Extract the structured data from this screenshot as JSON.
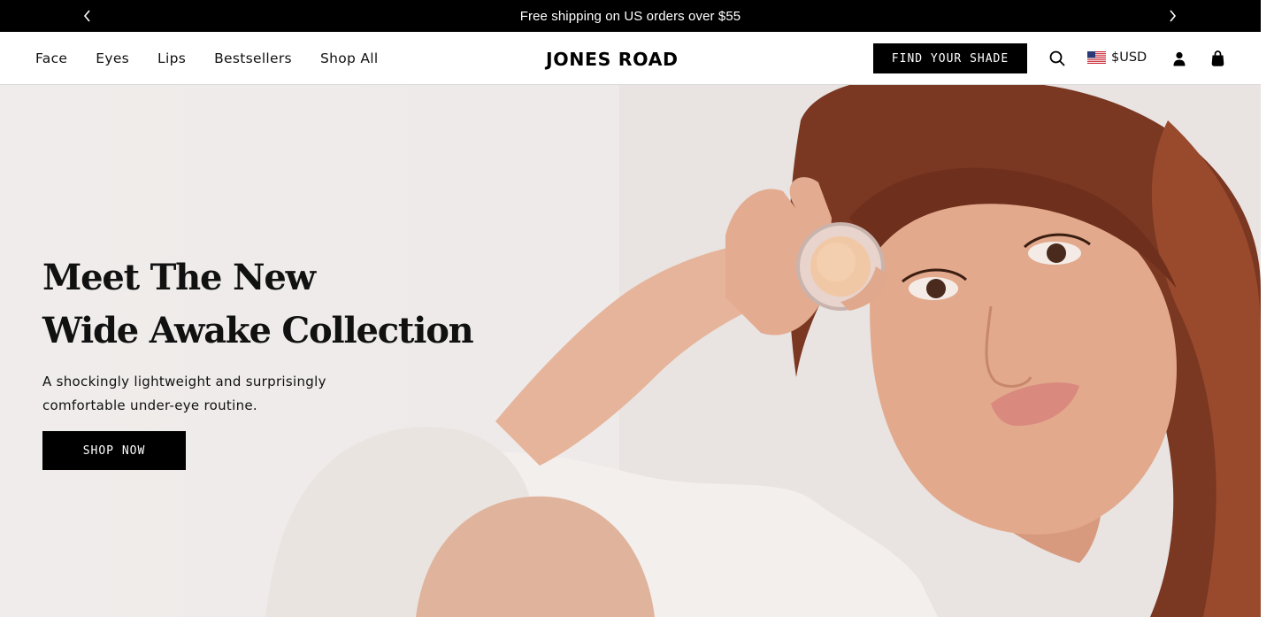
{
  "announcement": {
    "text": "Free shipping on US orders over $55",
    "prev_icon": "chevron-left-icon",
    "next_icon": "chevron-right-icon"
  },
  "header": {
    "nav": [
      "Face",
      "Eyes",
      "Lips",
      "Bestsellers",
      "Shop All"
    ],
    "logo": "JONES ROAD",
    "cta_label": "FIND YOUR SHADE",
    "currency": "$USD",
    "icons": [
      "search-icon",
      "us-flag-icon",
      "account-icon",
      "bag-icon"
    ]
  },
  "hero": {
    "title_line1": "Meet The New",
    "title_line2": "Wide Awake Collection",
    "subtitle_line1": "A shockingly lightweight and surprisingly",
    "subtitle_line2": "comfortable under-eye routine.",
    "button_label": "SHOP NOW",
    "image": "model-holding-compact-photo"
  },
  "colors": {
    "announcement_bg": "#000000",
    "button_bg": "#000000",
    "hero_bg": "#eeeae9",
    "text": "#111111"
  }
}
